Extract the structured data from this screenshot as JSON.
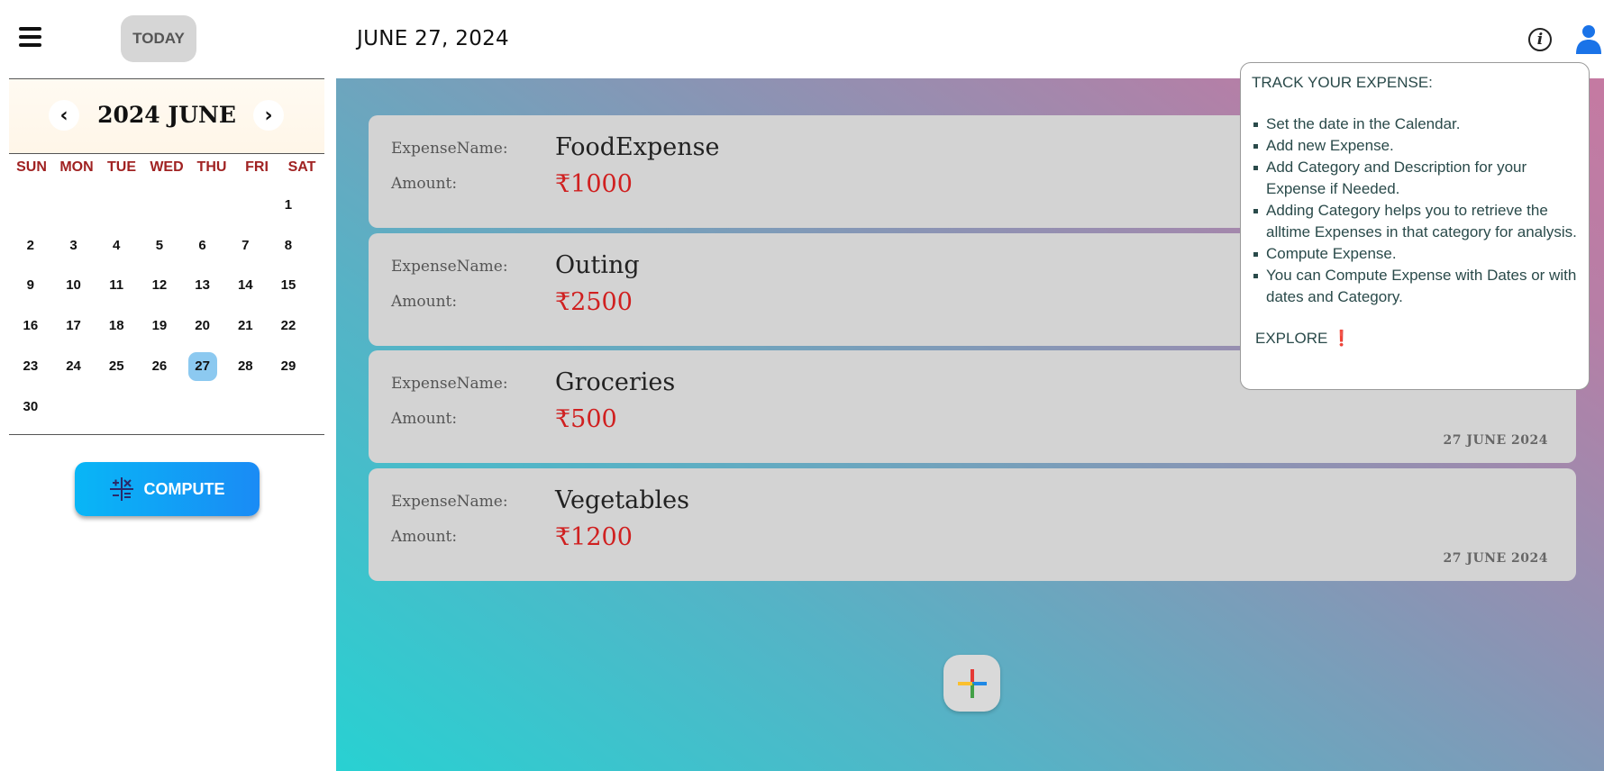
{
  "header": {
    "today_label": "TODAY",
    "current_date": "JUNE 27, 2024",
    "icons": [
      "menu-icon",
      "info-icon",
      "user-icon"
    ]
  },
  "calendar": {
    "title": "2024 JUNE",
    "weekdays": [
      "SUN",
      "MON",
      "TUE",
      "WED",
      "THU",
      "FRI",
      "SAT"
    ],
    "leading_blanks": 6,
    "days": [
      "1",
      "2",
      "3",
      "4",
      "5",
      "6",
      "7",
      "8",
      "9",
      "10",
      "11",
      "12",
      "13",
      "14",
      "15",
      "16",
      "17",
      "18",
      "19",
      "20",
      "21",
      "22",
      "23",
      "24",
      "25",
      "26",
      "27",
      "28",
      "29",
      "30"
    ],
    "selected_day": "27",
    "colors": {
      "weekday": "#a02222",
      "selected": "#8cc9f0"
    }
  },
  "sidebar": {
    "compute_label": "COMPUTE"
  },
  "expenses": {
    "name_label": "ExpenseName:",
    "amount_label": "Amount:",
    "items": [
      {
        "name": "FoodExpense",
        "amount": "₹1000",
        "date": ""
      },
      {
        "name": "Outing",
        "amount": "₹2500",
        "date": ""
      },
      {
        "name": "Groceries",
        "amount": "₹500",
        "date": "27 JUNE 2024"
      },
      {
        "name": "Vegetables",
        "amount": "₹1200",
        "date": "27 JUNE 2024"
      }
    ],
    "colors": {
      "amount": "#d02020",
      "card": "#d3d3d3"
    }
  },
  "info_popover": {
    "title": "TRACK YOUR EXPENSE:",
    "items": [
      "Set the date in the Calendar.",
      "Add new Expense.",
      "Add Category and Description for your Expense if Needed.",
      "Adding Category helps you to retrieve the alltime Expenses in that category for analysis.",
      "Compute Expense.",
      "You can Compute Expense with Dates or with dates and Category."
    ],
    "explore_label": "EXPLORE",
    "explore_mark": "❗"
  }
}
